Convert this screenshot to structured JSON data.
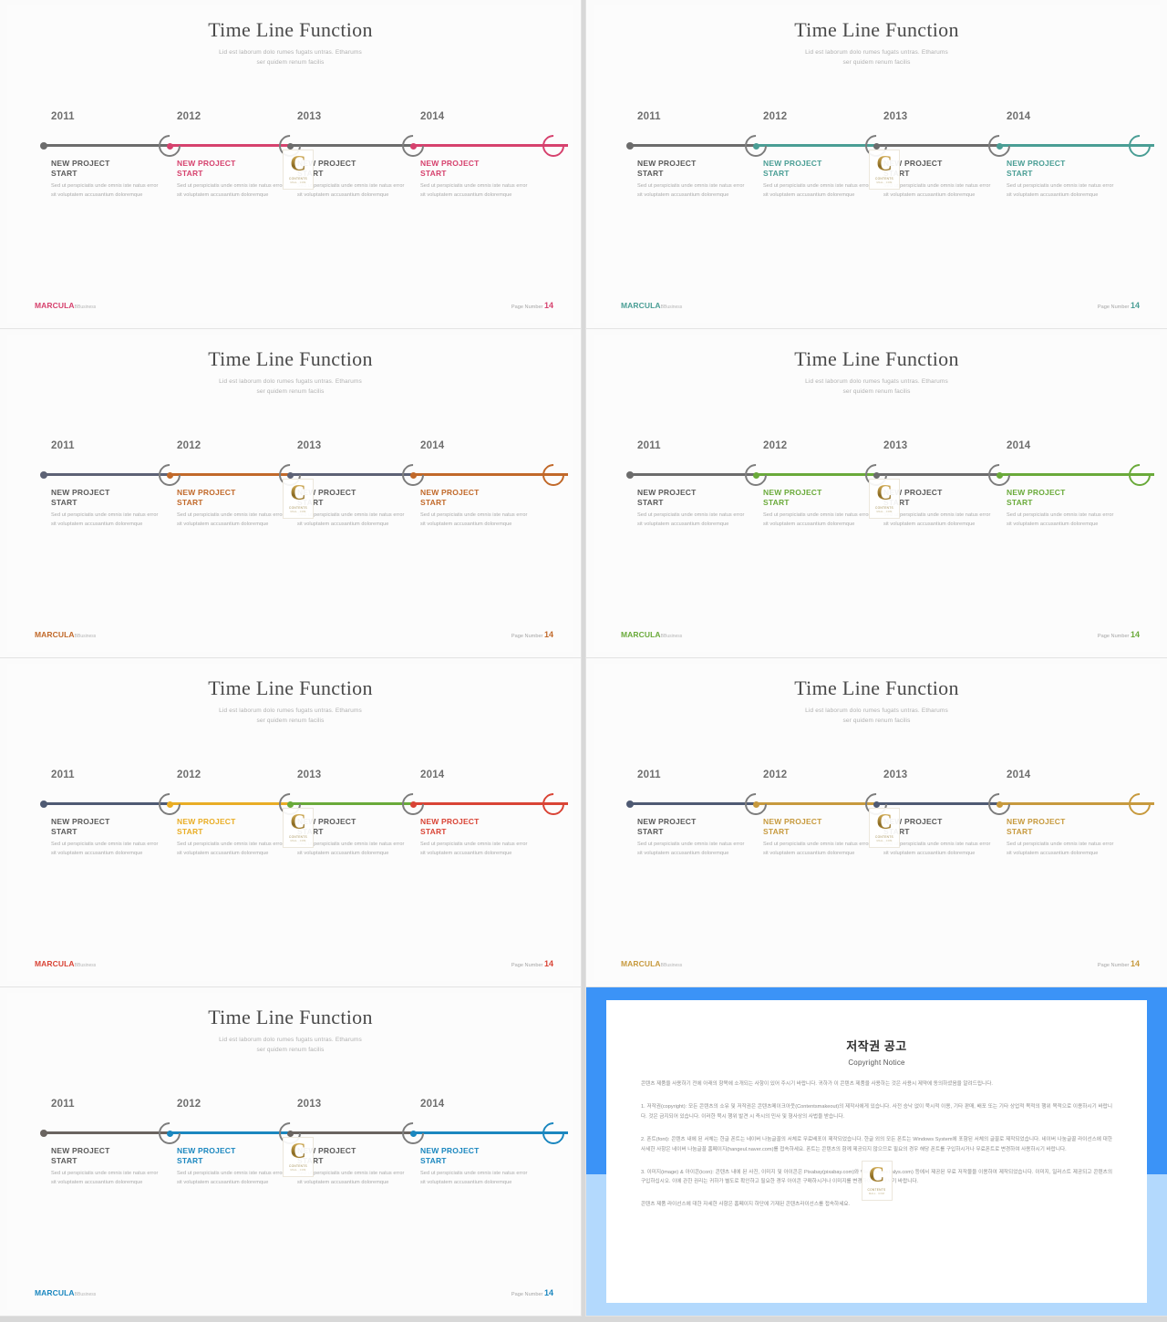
{
  "slide": {
    "title": "Time Line Function",
    "subtitle_line1": "Lid est laborum dolo rumes  fugats untras. Etharums",
    "subtitle_line2": "ser  quidem  renum  facilis",
    "body_text": "Sed ut perspiciatis  unde omnis iste natus error sit voluptatem accusantium doloremque",
    "item_title": "NEW PROJECT\nSTART",
    "years": [
      "2011",
      "2012",
      "2013",
      "2014"
    ],
    "brand_main": "MARCULA",
    "brand_sub": "BBusiness",
    "page_label": "Page Number",
    "page_number": "14",
    "badge_letter": "C",
    "badge_text1": "CONTENTS",
    "badge_text2": "MALL . COM"
  },
  "colors": {
    "neutral_line": "#6c6c6c",
    "ring": "#7d7d7d",
    "text_dark": "#4a4a4a",
    "body_gray": "#a9a9a9"
  },
  "variants": [
    {
      "id": "pink",
      "accent": "#d6426e",
      "base": "#6c6c6c",
      "segments": [
        "#6c6c6c",
        "#d6426e",
        "#6c6c6c",
        "#d6426e"
      ],
      "dots": [
        "#6c6c6c",
        "#d6426e",
        "#6c6c6c",
        "#d6426e"
      ],
      "titles": [
        "#5a5a5a",
        "#d6426e",
        "#5a5a5a",
        "#d6426e"
      ],
      "brand": "#d6426e"
    },
    {
      "id": "teal",
      "accent": "#4a9e95",
      "base": "#6c6c6c",
      "segments": [
        "#6c6c6c",
        "#4a9e95",
        "#6c6c6c",
        "#4a9e95"
      ],
      "dots": [
        "#6c6c6c",
        "#4a9e95",
        "#6c6c6c",
        "#4a9e95"
      ],
      "titles": [
        "#5a5a5a",
        "#4a9e95",
        "#5a5a5a",
        "#4a9e95"
      ],
      "brand": "#4a9e95"
    },
    {
      "id": "orange",
      "accent": "#c1692a",
      "base": "#5d6275",
      "segments": [
        "#5d6275",
        "#c1692a",
        "#5d6275",
        "#c1692a"
      ],
      "dots": [
        "#5d6275",
        "#c1692a",
        "#5d6275",
        "#c1692a"
      ],
      "titles": [
        "#5a5a5a",
        "#c1692a",
        "#5a5a5a",
        "#c1692a"
      ],
      "brand": "#c1692a"
    },
    {
      "id": "green",
      "accent": "#6aaa3a",
      "base": "#6c6c6c",
      "segments": [
        "#6c6c6c",
        "#6aaa3a",
        "#6c6c6c",
        "#6aaa3a"
      ],
      "dots": [
        "#6c6c6c",
        "#6aaa3a",
        "#6c6c6c",
        "#6aaa3a"
      ],
      "titles": [
        "#5a5a5a",
        "#6aaa3a",
        "#5a5a5a",
        "#6aaa3a"
      ],
      "brand": "#6aaa3a"
    },
    {
      "id": "multi",
      "accent": "#d94436",
      "base": "#4f5a73",
      "segments": [
        "#4f5a73",
        "#e9ad25",
        "#6aaa3a",
        "#d94436"
      ],
      "dots": [
        "#4f5a73",
        "#e9ad25",
        "#6aaa3a",
        "#d94436"
      ],
      "titles": [
        "#5a5a5a",
        "#e9ad25",
        "#5a5a5a",
        "#d94436"
      ],
      "brand": "#d94436"
    },
    {
      "id": "gold",
      "accent": "#c79a3e",
      "base": "#4f5a73",
      "segments": [
        "#4f5a73",
        "#c79a3e",
        "#4f5a73",
        "#c79a3e"
      ],
      "dots": [
        "#4f5a73",
        "#c79a3e",
        "#4f5a73",
        "#c79a3e"
      ],
      "titles": [
        "#5a5a5a",
        "#c79a3e",
        "#5a5a5a",
        "#c79a3e"
      ],
      "brand": "#c79a3e"
    },
    {
      "id": "blue",
      "accent": "#1b87bf",
      "base": "#6a6460",
      "segments": [
        "#6a6460",
        "#1b87bf",
        "#6a6460",
        "#1b87bf"
      ],
      "dots": [
        "#6a6460",
        "#1b87bf",
        "#6a6460",
        "#1b87bf"
      ],
      "titles": [
        "#5a5a5a",
        "#1b87bf",
        "#5a5a5a",
        "#1b87bf"
      ],
      "brand": "#1b87bf"
    }
  ],
  "copyright": {
    "heading_ko": "저작권 공고",
    "heading_en": "Copyright Notice",
    "paragraphs": [
      "콘텐츠 제품을 사용하기 전에 아래의 항목에 소개되는 사항이 있어 주시기 바랍니다. 귀하가 이 콘텐츠 제품을 사용하는 것은 사용시 제약에 동의하셨음을 알려드립니다.",
      "1. 저작권(copyright): 모든 콘텐츠의 소유 및 저작권은 콘텐츠메이크아웃(Contentsmakeout)의 제작사에게 있습니다. 사전 승낙 없이 묵시적 이용, 기타 판매, 배포 또는 기타 상업적 목적의 행위 목적으로 이용하시기 바랍니다. 것은 금지되어 있습니다. 이러한 묵시 행위 발견 시 즉시의 민사 및 형사상의 사법을 받습니다.",
      "2. 폰트(font): 콘텐츠 내에 된 서체는 한글 폰트는 네이버 나눔글꼴의 서체로 무료배포이 제작되었습니다. 한글 외의 모든 폰트는 Windows System에 포함된 서체의 글꼴로 제작되었습니다. 네이버 나눔글꼴 라이선스에 대한 사세한 사항은 네이버 나눔글꼴 홈페이지(hangeul.naver.com)를 접속하세요. 폰트는 콘텐츠의 함께 제공되지 않으므로 필요의 경우 해당 폰트를 구입하시거나 무료폰트로 변경하여 사용하시기 바랍니다.",
      "3. 이미지(image) & 아이콘(icon): 콘텐츠 내에 된 사진, 이미지 및 아이콘은 Pixabay(pixabay.com)와 Webalys(webalys.com) 등에서 제공된 무료 저작물을 이용하여 제작되었습니다. 이미지, 일러스트 제공되고 콘텐츠의 구입하십시오. 이에 관한 권리는 귀하가 별도로 확인하고 필요한 경우 아이콘 구매하시거나 이미지를 변경하여 사용하시기 바랍니다.",
      "콘텐츠 제품 라이선스에 대한 자세한 사항은 홈페이지 하단에 기재된 콘텐츠라이선스를 접속하세요."
    ]
  }
}
